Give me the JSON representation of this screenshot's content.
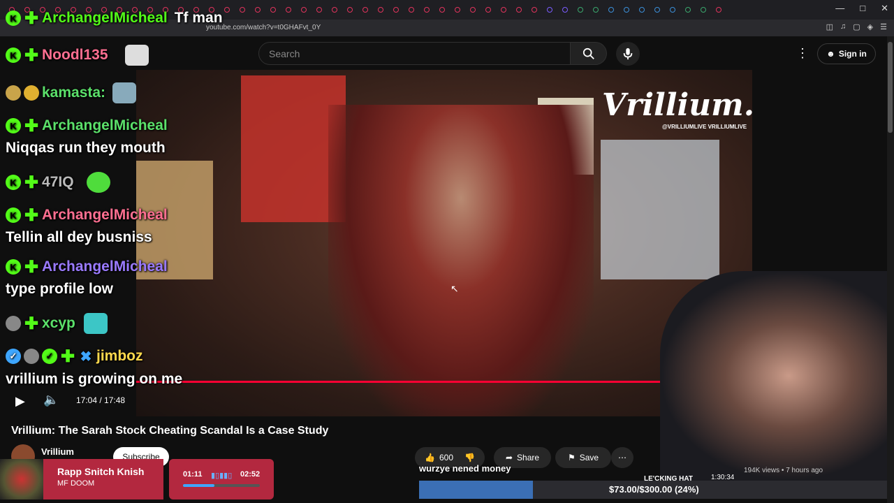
{
  "browser": {
    "url": "youtube.com/watch?v=t0GHAFvt_0Y"
  },
  "youtube": {
    "search_placeholder": "Search",
    "signin_label": "Sign in",
    "video_title": "Vrillium: The Sarah Stock Cheating Scandal Is a Case Study",
    "channel_name": "Vrillium",
    "subscribe_label": "Subscribe",
    "likes": "600",
    "share_label": "Share",
    "save_label": "Save",
    "time_display": "17:04 / 17:48",
    "views_meta": "194K views • 7 hours ago",
    "watermark": "Vrillium.",
    "watermark_social": "@VRILLIUMLIVE  VRILLIUMLIVE"
  },
  "chat": [
    {
      "user": "ArchangelMicheal",
      "message": "Tf man",
      "color": "user-green"
    },
    {
      "user": "Noodl135",
      "message": "",
      "color": "user-pink"
    },
    {
      "user": "kamasta:",
      "message": "",
      "color": "user-lightgreen"
    },
    {
      "user": "ArchangelMicheal",
      "message": "Niqqas run they mouth",
      "color": "user-lightgreen"
    },
    {
      "user": "47IQ",
      "message": "",
      "color": "user-gray"
    },
    {
      "user": "ArchangelMicheal",
      "message": "Tellin all dey busniss",
      "color": "user-pink"
    },
    {
      "user": "ArchangelMicheal",
      "message": "type profile low",
      "color": "user-purple"
    },
    {
      "user": "xcyp",
      "message": "",
      "color": "user-lightgreen"
    },
    {
      "user": "jimboz",
      "message": "vrillium is growing on me",
      "color": "user-yellow"
    }
  ],
  "overlay": {
    "tts_text": "wurzye nened money",
    "goal_text": "$73.00/$300.00 (24%)",
    "goal_fraction": 0.24,
    "webcam_caption": "LE'CKING HAT",
    "webcam_time": "1:30:34"
  },
  "now_playing": {
    "track": "Rapp Snitch Knish",
    "artist": "MF DOOM",
    "elapsed": "01:11",
    "total": "02:52"
  },
  "colors": {
    "progress": "#ff0033",
    "kick_green": "#53fc18",
    "np_red": "#b3283f"
  }
}
